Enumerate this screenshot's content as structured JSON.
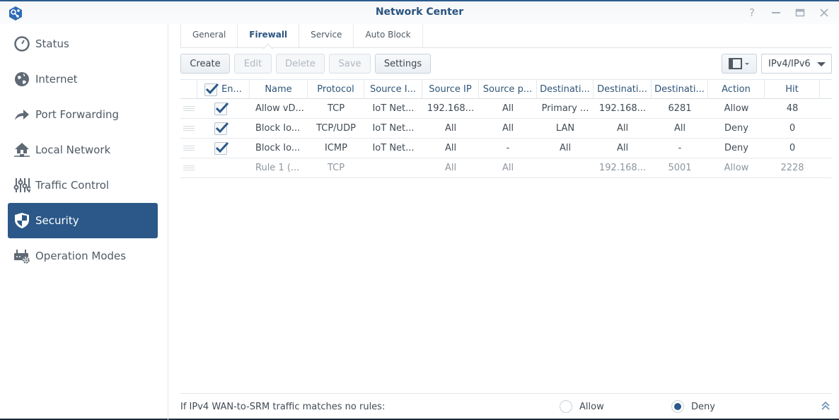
{
  "window": {
    "title": "Network Center",
    "controls": [
      "help",
      "minimize",
      "maximize",
      "close"
    ]
  },
  "sidebar": {
    "items": [
      {
        "label": "Status",
        "icon": "gauge-icon",
        "active": false
      },
      {
        "label": "Internet",
        "icon": "globe-icon",
        "active": false
      },
      {
        "label": "Port Forwarding",
        "icon": "forward-arrow-icon",
        "active": false
      },
      {
        "label": "Local Network",
        "icon": "home-network-icon",
        "active": false
      },
      {
        "label": "Traffic Control",
        "icon": "sliders-icon",
        "active": false
      },
      {
        "label": "Security",
        "icon": "shield-icon",
        "active": true
      },
      {
        "label": "Operation Modes",
        "icon": "router-gear-icon",
        "active": false
      }
    ]
  },
  "tabs": [
    {
      "label": "General",
      "active": false
    },
    {
      "label": "Firewall",
      "active": true
    },
    {
      "label": "Service",
      "active": false
    },
    {
      "label": "Auto Block",
      "active": false
    }
  ],
  "toolbar": {
    "create": "Create",
    "edit": "Edit",
    "delete": "Delete",
    "save": "Save",
    "settings": "Settings",
    "ip_version": "IPv4/IPv6"
  },
  "grid": {
    "columns": [
      "En...",
      "Name",
      "Protocol",
      "Source I...",
      "Source IP",
      "Source p...",
      "Destinati...",
      "Destinati...",
      "Destinati...",
      "Action",
      "Hit"
    ],
    "rows": [
      {
        "enabled": true,
        "cells": [
          "Allow vD...",
          "TCP",
          "IoT Net...",
          "192.168...",
          "All",
          "Primary ...",
          "192.168...",
          "6281",
          "Allow",
          "48"
        ]
      },
      {
        "enabled": true,
        "cells": [
          "Block Io...",
          "TCP/UDP",
          "IoT Net...",
          "All",
          "All",
          "LAN",
          "All",
          "All",
          "Deny",
          "0"
        ]
      },
      {
        "enabled": true,
        "cells": [
          "Block Io...",
          "ICMP",
          "IoT Net...",
          "All",
          "-",
          "All",
          "All",
          "-",
          "Deny",
          "0"
        ]
      },
      {
        "enabled": false,
        "cells": [
          "Rule 1 (...",
          "TCP",
          "",
          "All",
          "All",
          "",
          "192.168...",
          "5001",
          "Allow",
          "2228"
        ]
      }
    ]
  },
  "footer": {
    "label": "If IPv4 WAN-to-SRM traffic matches no rules:",
    "options": [
      {
        "label": "Allow",
        "selected": false
      },
      {
        "label": "Deny",
        "selected": true
      }
    ]
  },
  "colors": {
    "accent": "#2b5888",
    "title": "#2a5380"
  }
}
